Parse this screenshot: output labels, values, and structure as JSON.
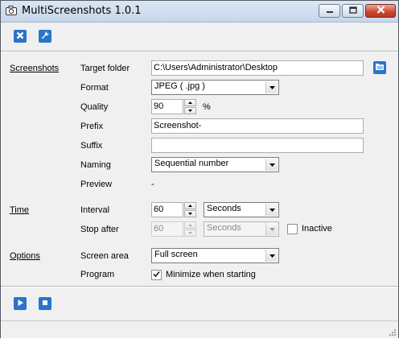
{
  "window": {
    "title": "MultiScreenshots 1.0.1",
    "icon": "camera-icon"
  },
  "toolbar": {
    "buttons": [
      {
        "name": "close-settings-button",
        "icon": "close-x-icon"
      },
      {
        "name": "tools-settings-button",
        "icon": "wrench-icon"
      }
    ]
  },
  "sections": {
    "screenshots": "Screenshots",
    "time": "Time",
    "options": "Options"
  },
  "screenshots": {
    "target_folder_label": "Target folder",
    "target_folder_value": "C:\\Users\\Administrator\\Desktop",
    "browse_icon": "folder-browse-icon",
    "format_label": "Format",
    "format_value": "JPEG ( .jpg )",
    "quality_label": "Quality",
    "quality_value": "90",
    "quality_unit": "%",
    "prefix_label": "Prefix",
    "prefix_value": "Screenshot-",
    "suffix_label": "Suffix",
    "suffix_value": "",
    "naming_label": "Naming",
    "naming_value": "Sequential number",
    "preview_label": "Preview",
    "preview_value": "-"
  },
  "time": {
    "interval_label": "Interval",
    "interval_value": "60",
    "interval_unit": "Seconds",
    "stop_after_label": "Stop after",
    "stop_after_value": "60",
    "stop_after_unit": "Seconds",
    "inactive_label": "Inactive",
    "inactive_checked": false
  },
  "options": {
    "screen_area_label": "Screen area",
    "screen_area_value": "Full screen",
    "program_label": "Program",
    "minimize_label": "Minimize when starting",
    "minimize_checked": true
  },
  "footer": {
    "play_icon": "play-icon",
    "stop_icon": "stop-icon"
  },
  "colors": {
    "accent": "#1f6fc4",
    "titlebar": "#c6d6ea",
    "close_button": "#c9452c"
  }
}
